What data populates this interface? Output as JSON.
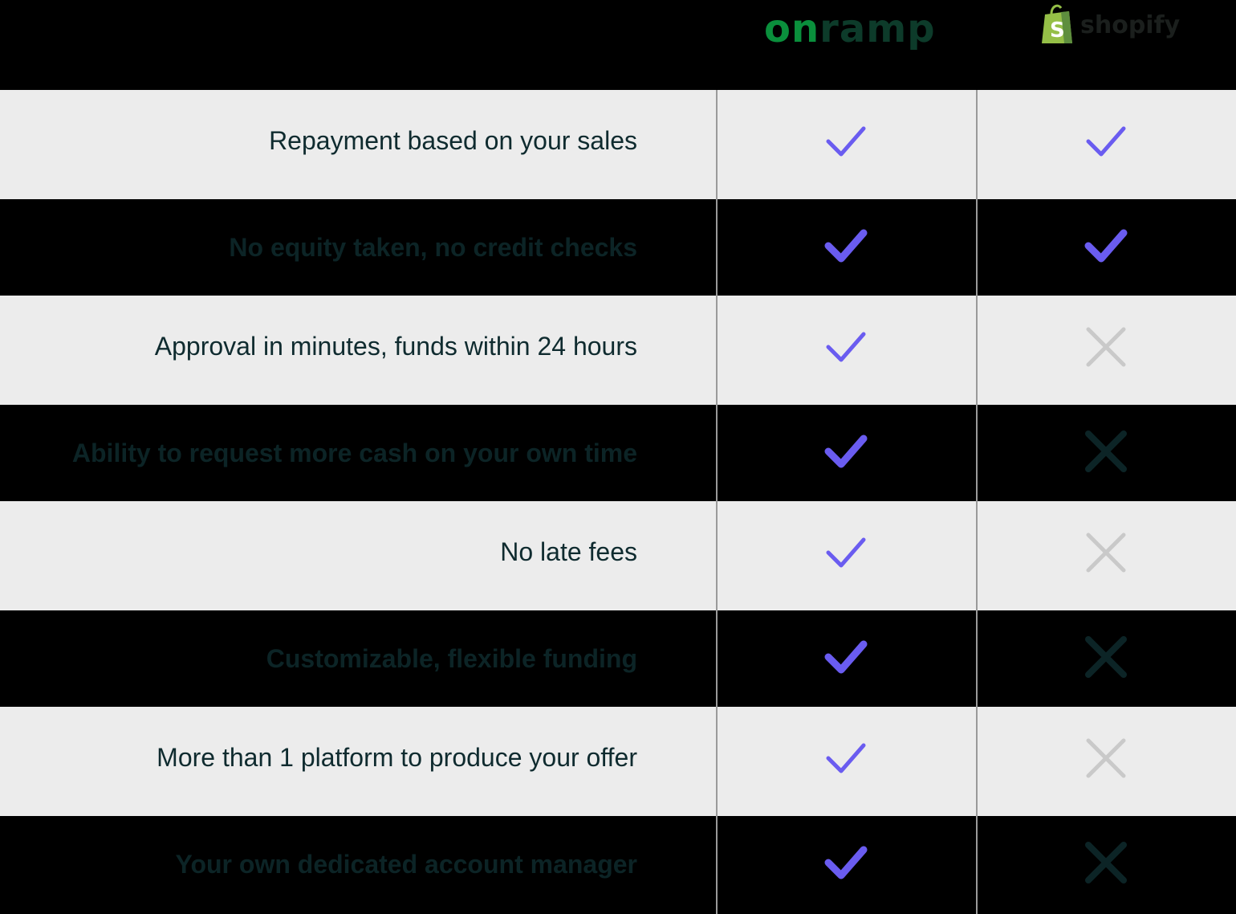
{
  "header": {
    "onramp_logo": {
      "part1": "on",
      "part2": "ramp"
    },
    "shopify_logo": {
      "bag_letter": "S",
      "word": "shopify"
    }
  },
  "rows": [
    {
      "label": "Repayment based on your sales",
      "onramp": "check",
      "shopify": "check"
    },
    {
      "label": "No equity taken, no credit checks",
      "onramp": "check",
      "shopify": "check"
    },
    {
      "label": "Approval in minutes, funds within 24 hours",
      "onramp": "check",
      "shopify": "cross"
    },
    {
      "label": "Ability to request more cash on your own time",
      "onramp": "check",
      "shopify": "cross"
    },
    {
      "label": "No late fees",
      "onramp": "check",
      "shopify": "cross"
    },
    {
      "label": "Customizable, flexible funding",
      "onramp": "check",
      "shopify": "cross"
    },
    {
      "label": "More than 1 platform to produce your offer",
      "onramp": "check",
      "shopify": "cross"
    },
    {
      "label": "Your own dedicated account manager",
      "onramp": "check",
      "shopify": "cross"
    }
  ],
  "colors": {
    "check": "#6a5cf0",
    "cross_light": "#c9c9c9",
    "cross_dark": "#0c2426",
    "text": "#0f2b2f",
    "light_row": "#ececec",
    "dark_row": "#000000"
  },
  "icons": {
    "check": "check-icon",
    "cross": "cross-icon",
    "shopify_bag": "shopping-bag-icon"
  }
}
